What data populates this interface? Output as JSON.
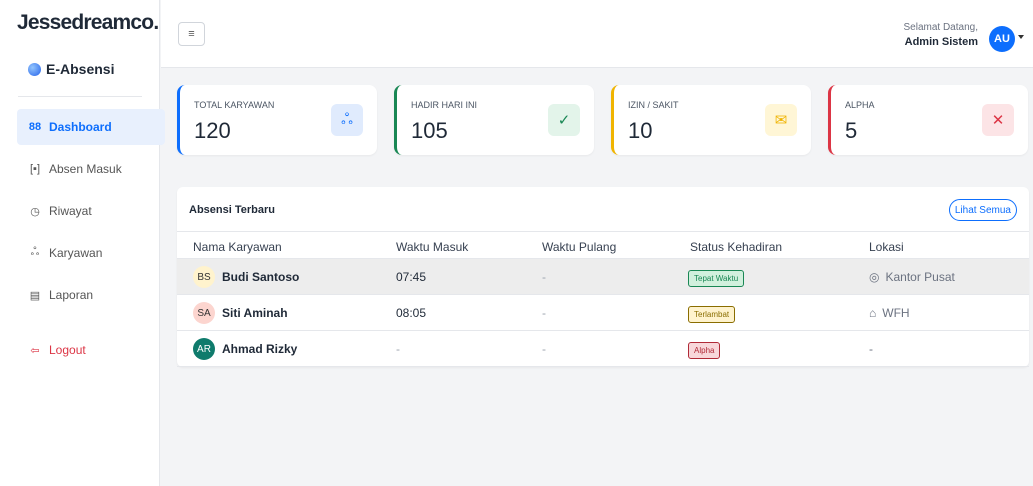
{
  "sidebar": {
    "brand": "Jessedreamco.",
    "app_name": "E-Absensi",
    "items": [
      {
        "label": "Dashboard",
        "icon": "grid-icon",
        "glyph": "88"
      },
      {
        "label": "Absen Masuk",
        "icon": "scan-icon",
        "glyph": "[▪]"
      },
      {
        "label": "Riwayat",
        "icon": "clock-icon",
        "glyph": "◷"
      },
      {
        "label": "Karyawan",
        "icon": "users-icon",
        "glyph": "ஃ"
      },
      {
        "label": "Laporan",
        "icon": "file-icon",
        "glyph": "▤"
      }
    ],
    "logout": {
      "label": "Logout",
      "glyph": "⇦"
    }
  },
  "topbar": {
    "menu_glyph": "≡",
    "welcome_text": "Selamat Datang,",
    "user_name": "Admin Sistem",
    "avatar_initials": "AU"
  },
  "stats": [
    {
      "label": "TOTAL KARYAWAN",
      "value": "120",
      "glyph": "ஃ",
      "icon": "users-icon",
      "color": "#0d6efd",
      "bg": "#e0ebfd"
    },
    {
      "label": "HADIR HARI INI",
      "value": "105",
      "glyph": "✓",
      "icon": "check-icon",
      "color": "#198754",
      "bg": "#e3f4ea"
    },
    {
      "label": "IZIN / SAKIT",
      "value": "10",
      "glyph": "✉",
      "icon": "envelope-icon",
      "color": "#f0b400",
      "bg": "#fff6d6"
    },
    {
      "label": "ALPHA",
      "value": "5",
      "glyph": "✕",
      "icon": "x-icon",
      "color": "#dc3545",
      "bg": "#fce4e6"
    }
  ],
  "attendance": {
    "title": "Absensi Terbaru",
    "view_all": "Lihat Semua",
    "headers": [
      "Nama Karyawan",
      "Waktu Masuk",
      "Waktu Pulang",
      "Status Kehadiran",
      "Lokasi"
    ],
    "rows": [
      {
        "initials": "BS",
        "name": "Budi Santoso",
        "in": "07:45",
        "out": "-",
        "status": "Tepat Waktu",
        "status_color": "#198754",
        "status_bg": "#d1f0dd",
        "location": "Kantor Pusat",
        "loc_glyph": "◎",
        "ava_bg": "#fff3cd",
        "ava_fg": "#333333"
      },
      {
        "initials": "SA",
        "name": "Siti Aminah",
        "in": "08:05",
        "out": "-",
        "status": "Terlambat",
        "status_color": "#8a6d00",
        "status_bg": "#fff3cd",
        "location": "WFH",
        "loc_glyph": "⌂",
        "ava_bg": "#fcd5cf",
        "ava_fg": "#333333"
      },
      {
        "initials": "AR",
        "name": "Ahmad Rizky",
        "in": "-",
        "out": "-",
        "status": "Alpha",
        "status_color": "#b02a37",
        "status_bg": "#f8d7da",
        "location": "-",
        "loc_glyph": "",
        "ava_bg": "#0f7b6c",
        "ava_fg": "#ffffff"
      }
    ]
  }
}
